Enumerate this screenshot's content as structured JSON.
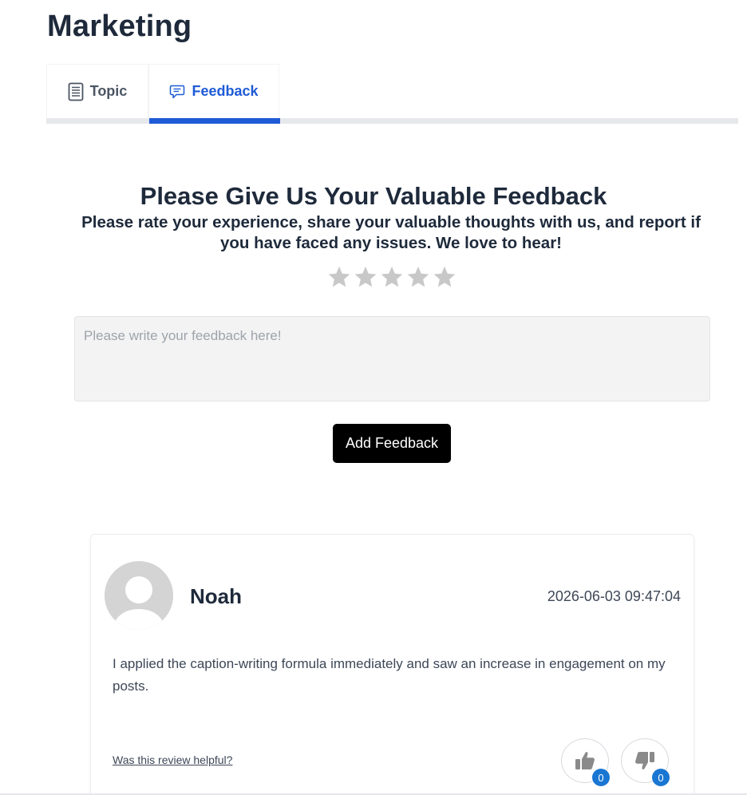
{
  "page": {
    "title": "Marketing"
  },
  "tabs": [
    {
      "label": "Topic",
      "icon": "document-icon",
      "active": false
    },
    {
      "label": "Feedback",
      "icon": "chat-bubble-icon",
      "active": true
    }
  ],
  "feedback_form": {
    "heading": "Please Give Us Your Valuable Feedback",
    "subheading": "Please rate your experience, share your valuable thoughts with us, and report if you have faced any issues. We love to hear!",
    "rating": {
      "max": 5,
      "value": 0
    },
    "placeholder": "Please write your feedback here!",
    "value": "",
    "submit_label": "Add Feedback"
  },
  "reviews": [
    {
      "name": "Noah",
      "date": "2026-06-03 09:47:04",
      "text": "I applied the caption-writing formula immediately and saw an increase in engagement on my posts.",
      "helpful_label": "Was this review helpful?",
      "likes": "0",
      "dislikes": "0"
    }
  ],
  "colors": {
    "accent": "#1e5bd6",
    "badge": "#1976d2",
    "star_inactive": "#c8c8c8",
    "button_bg": "#000000"
  }
}
